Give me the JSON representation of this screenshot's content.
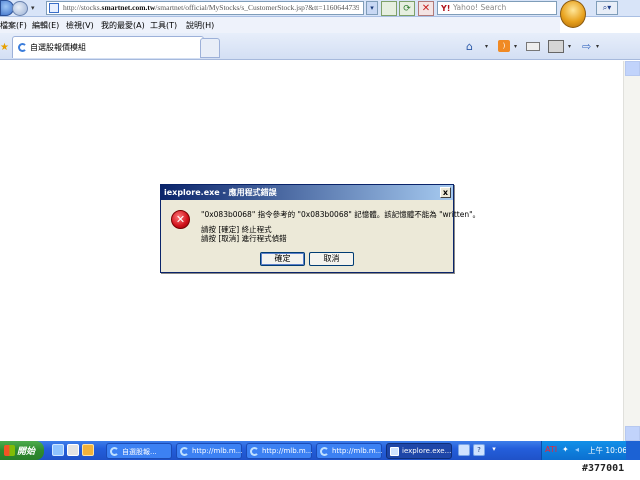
{
  "browser": {
    "address_prefix": "http://stocks.",
    "address_domain": "smartnet.com.tw",
    "address_suffix": "/smartnet/official/MyStocks/s_CustomerStock.jsp?&tt=1160644739",
    "search_placeholder": "Yahoo! Search",
    "search_logo": "Y!",
    "menu": [
      "檔案(F)",
      "編輯(E)",
      "檢視(V)",
      "我的最愛(A)",
      "工具(T)",
      "說明(H)"
    ],
    "tab_title": "自選股報價模組"
  },
  "dialog": {
    "title": "iexplore.exe - 應用程式錯誤",
    "message": "\"0x083b0068\" 指令參考的 \"0x083b0068\" 記憶體。該記憶體不能為 \"written\"。",
    "line1": "請按 [確定] 終止程式",
    "line2": "請按 [取消] 進行程式偵錯",
    "ok_label": "確定",
    "cancel_label": "取消",
    "close_glyph": "x"
  },
  "taskbar": {
    "start_label": "開始",
    "tasks": [
      {
        "label": "自選股報..."
      },
      {
        "label": "http://mlb.m..."
      },
      {
        "label": "http://mlb.m..."
      },
      {
        "label": "http://mlb.m..."
      },
      {
        "label": "iexplore.exe..."
      }
    ],
    "clock": "上午 10:06"
  },
  "watermark": "#377001"
}
